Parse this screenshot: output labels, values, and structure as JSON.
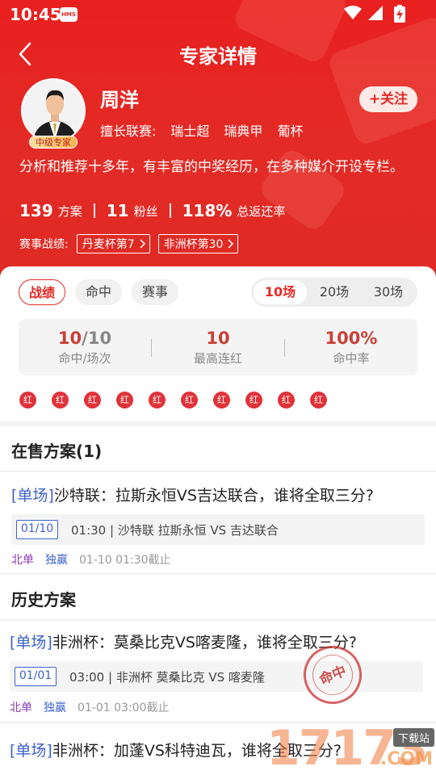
{
  "status_bar": {
    "time": "10:45",
    "app_badge": "HMS"
  },
  "header": {
    "title": "专家详情"
  },
  "expert": {
    "name": "周洋",
    "level": "中级专家",
    "follow_label": "+关注",
    "leagues_label": "擅长联赛:",
    "leagues": [
      "瑞士超",
      "瑞典甲",
      "葡杯"
    ],
    "intro": "分析和推荐十多年，有丰富的中奖经历，在多种媒介开设专栏。",
    "stats": [
      {
        "value": "139",
        "label": "方案"
      },
      {
        "value": "11",
        "label": "粉丝"
      },
      {
        "value": "118%",
        "label": "总返还率"
      }
    ],
    "record_label": "赛事战绩:",
    "records": [
      "丹麦杯第7",
      "非洲杯第30"
    ]
  },
  "performance": {
    "tabs": [
      "战绩",
      "命中",
      "赛事"
    ],
    "active_tab": "战绩",
    "ranges": [
      "10场",
      "20场",
      "30场"
    ],
    "active_range": "10场",
    "summary": [
      {
        "hit": "10",
        "total": "10",
        "label": "命中/场次"
      },
      {
        "value": "10",
        "label": "最高连红"
      },
      {
        "value": "100%",
        "label": "命中率"
      }
    ],
    "results": [
      "红",
      "红",
      "红",
      "红",
      "红",
      "红",
      "红",
      "红",
      "红",
      "红"
    ]
  },
  "on_sale": {
    "heading": "在售方案(1)",
    "plans": [
      {
        "title_tag": "[单场]",
        "title": "沙特联：拉斯永恒VS吉达联合，谁将全取三分?",
        "date": "01/10",
        "info": "01:30 | 沙特联 拉斯永恒 VS 吉达联合",
        "meta": [
          "北单",
          "独赢",
          "01-10 01:30截止"
        ]
      }
    ]
  },
  "history": {
    "heading": "历史方案",
    "plans": [
      {
        "title_tag": "[单场]",
        "title": "非洲杯：莫桑比克VS喀麦隆，谁将全取三分?",
        "date": "01/01",
        "info": "03:00 | 非洲杯 莫桑比克 VS 喀麦隆",
        "meta": [
          "北单",
          "独赢",
          "01-01 03:00截止"
        ],
        "stamp": "命中"
      },
      {
        "title_tag": "[单场]",
        "title": "非洲杯：加蓬VS科特迪瓦，谁将全取三分?"
      }
    ]
  },
  "watermark": {
    "number": "17173",
    "badge": "下载站",
    "domain": ".COM"
  }
}
